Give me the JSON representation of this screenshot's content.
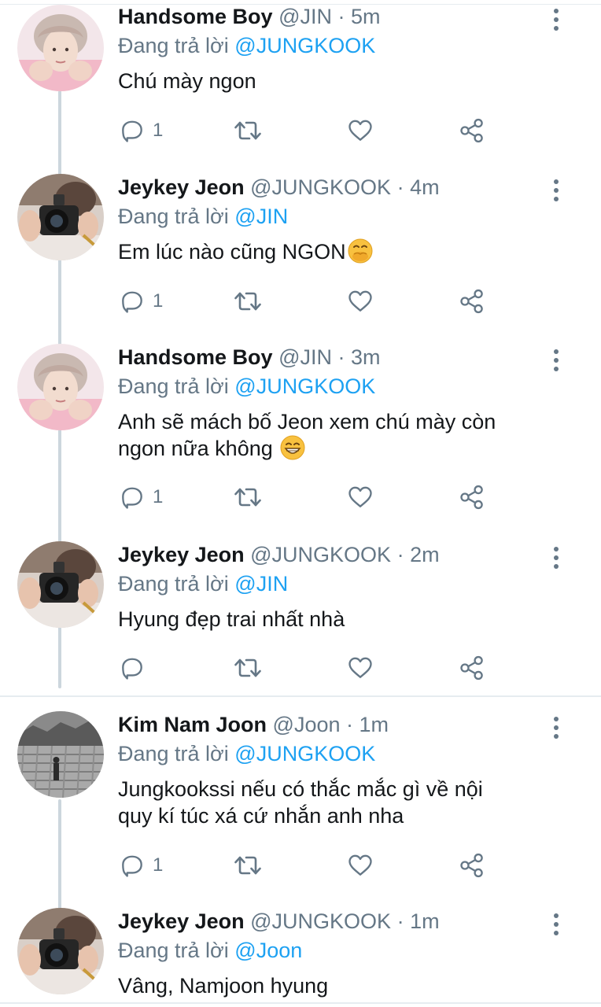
{
  "thread": [
    {
      "author": {
        "display_name": "Handsome Boy",
        "handle": "@JIN",
        "avatar": "jin-avatar"
      },
      "time": "5m",
      "reply_prefix": "Đang trả lời",
      "reply_to": "@JUNGKOOK",
      "text": "Chú mày ngon",
      "emoji": null,
      "reply_count": "1"
    },
    {
      "author": {
        "display_name": "Jeykey Jeon",
        "handle": "@JUNGKOOK",
        "avatar": "jungkook-camera-avatar"
      },
      "time": "4m",
      "reply_prefix": "Đang trả lời",
      "reply_to": "@JIN",
      "text": "Em lúc nào cũng NGON",
      "emoji": "face-with-hand-over-mouth",
      "reply_count": "1"
    },
    {
      "author": {
        "display_name": "Handsome Boy",
        "handle": "@JIN",
        "avatar": "jin-avatar"
      },
      "time": "3m",
      "reply_prefix": "Đang trả lời",
      "reply_to": "@JUNGKOOK",
      "text_line1": "Anh sẽ mách bố Jeon xem chú mày còn",
      "text_line2": "ngon nữa không",
      "emoji": "grinning-face",
      "reply_count": "1"
    },
    {
      "author": {
        "display_name": "Jeykey Jeon",
        "handle": "@JUNGKOOK",
        "avatar": "jungkook-camera-avatar"
      },
      "time": "2m",
      "reply_prefix": "Đang trả lời",
      "reply_to": "@JIN",
      "text": "Hyung đẹp trai nhất nhà",
      "emoji": null,
      "reply_count": ""
    },
    {
      "author": {
        "display_name": "Kim Nam Joon",
        "handle": "@Joon",
        "avatar": "namjoon-landscape-avatar"
      },
      "time": "1m",
      "reply_prefix": "Đang trả lời",
      "reply_to": "@JUNGKOOK",
      "text_line1": "Jungkookssi nếu có thắc mắc gì về nội",
      "text_line2": "quy kí túc xá cứ nhắn anh nha",
      "emoji": null,
      "reply_count": "1"
    },
    {
      "author": {
        "display_name": "Jeykey Jeon",
        "handle": "@JUNGKOOK",
        "avatar": "jungkook-camera-avatar"
      },
      "time": "1m",
      "reply_prefix": "Đang trả lời",
      "reply_to": "@Joon",
      "text": "Vâng, Namjoon hyung",
      "emoji": null,
      "reply_count": ""
    }
  ],
  "meta_separator": " · ",
  "colors": {
    "text": "#14171a",
    "secondary": "#657786",
    "accent": "#1da1f2",
    "thread_line": "#ccd6dd",
    "divider": "#e6ecf0"
  },
  "icons": [
    "reply-icon",
    "retweet-icon",
    "like-icon",
    "share-icon",
    "more-options-icon"
  ]
}
